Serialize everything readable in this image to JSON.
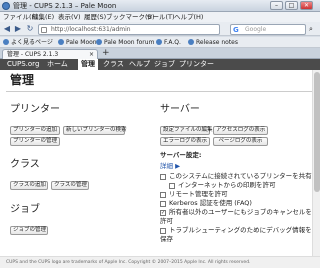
{
  "window": {
    "title": "管理 - CUPS 2.1.3 – Pale Moon",
    "min": "–",
    "max": "□",
    "close": "✕"
  },
  "menubar": [
    "ファイル(F)",
    "編集(E)",
    "表示(V)",
    "履歴(S)",
    "ブックマーク(B)",
    "ツール(T)",
    "ヘルプ(H)"
  ],
  "navbar": {
    "back": "◀",
    "forward": "▶",
    "reload": "↻",
    "url": "http://localhost:631/admin",
    "search_placeholder": "Google"
  },
  "bookmarks": [
    "よく見るページ",
    "Pale Moon",
    "Pale Moon forum",
    "F.A.Q.",
    "Release notes"
  ],
  "tabs": {
    "active": "管理 - CUPS 2.1.3",
    "close": "×",
    "new": "+"
  },
  "topnav": [
    "CUPS.org",
    "ホーム",
    "管理",
    "クラス",
    "ヘルプ",
    "ジョブ",
    "プリンター"
  ],
  "page": {
    "title": "管理",
    "printers": {
      "heading": "プリンター",
      "add": "プリンターの追加",
      "find": "新しいプリンターの検索",
      "manage": "プリンターの管理"
    },
    "classes": {
      "heading": "クラス",
      "add": "クラスの追加",
      "manage": "クラスの管理"
    },
    "jobs": {
      "heading": "ジョブ",
      "manage": "ジョブの管理"
    },
    "server": {
      "heading": "サーバー",
      "edit_config": "設定ファイルの編集",
      "access_log": "アクセスログの表示",
      "error_log": "エラーログの表示",
      "page_log": "ページログの表示",
      "settings_heading": "サーバー設定:",
      "advanced": "詳細 ▶",
      "options": [
        {
          "label": "このシステムに接続されているプリンターを共有",
          "checked": ""
        },
        {
          "label": "インターネットからの印刷を許可",
          "checked": ""
        },
        {
          "label": "リモート管理を許可",
          "checked": ""
        },
        {
          "label": "Kerberos 認証を使用 (FAQ)",
          "checked": ""
        },
        {
          "label": "所有者以外のユーザーにもジョブのキャンセルを",
          "checked": "✓"
        },
        {
          "label": "許可",
          "checked": ""
        },
        {
          "label": "トラブルシューティングのためにデバッグ情報を",
          "checked": ""
        },
        {
          "label": "保存",
          "checked": ""
        }
      ]
    }
  },
  "footer": "CUPS and the CUPS logo are trademarks of Apple Inc. Copyright © 2007–2015 Apple Inc. All rights reserved."
}
